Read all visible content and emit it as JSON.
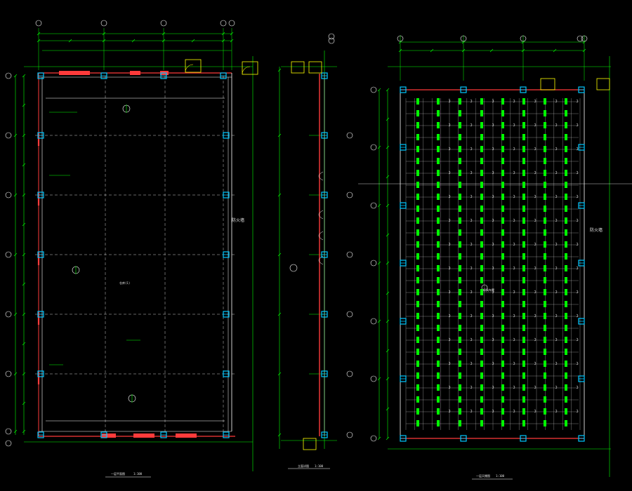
{
  "drawing": {
    "background": "#000000",
    "colors": {
      "dimension": "#00ff00",
      "grid_axis": "#ffffff",
      "wall": "#ff3b3b",
      "column": "#00c8ff",
      "door": "#ffff00",
      "fixture": "#00ff00",
      "text": "#e8e8e8"
    },
    "plans": [
      {
        "id": "plan-a",
        "title": "一层平面图",
        "scale": "1:100",
        "fire_wall_label": "防火墙",
        "room_label": "仓库(1)"
      },
      {
        "id": "plan-b",
        "title": "立面详图",
        "scale": "1:100"
      },
      {
        "id": "plan-c",
        "title": "一层天棚图",
        "scale": "1:100",
        "fire_wall_label": "防火墙",
        "center_label": "灯具布置"
      }
    ]
  }
}
